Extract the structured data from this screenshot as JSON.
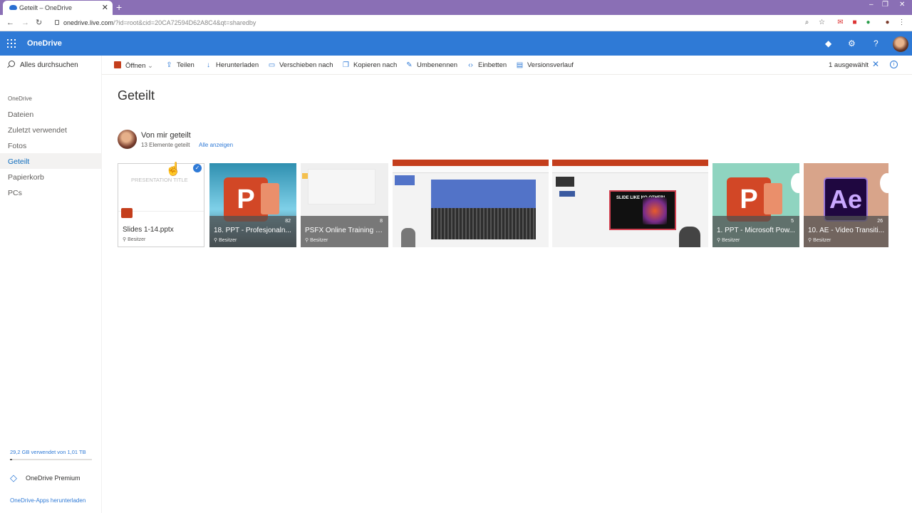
{
  "browser": {
    "tab_title": "Geteilt – OneDrive",
    "new_tab": "+",
    "url_host": "onedrive.live.com",
    "url_rest": "/?id=root&cid=20CA72594D62A8C4&qt=sharedby"
  },
  "suite": {
    "brand": "OneDrive",
    "icons": [
      "diamond-icon",
      "gear-icon",
      "help-icon"
    ]
  },
  "sidebar": {
    "search_label": "Alles durchsuchen",
    "section_label": "OneDrive",
    "items": [
      {
        "label": "Dateien",
        "active": false
      },
      {
        "label": "Zuletzt verwendet",
        "active": false
      },
      {
        "label": "Fotos",
        "active": false
      },
      {
        "label": "Geteilt",
        "active": true
      },
      {
        "label": "Papierkorb",
        "active": false
      },
      {
        "label": "PCs",
        "active": false
      }
    ],
    "storage_text": "29,2 GB verwendet von 1,01 TB",
    "storage_used_fraction": 0.03,
    "premium_label": "OneDrive Premium",
    "apps_label": "OneDrive-Apps herunterladen"
  },
  "commandbar": {
    "open": "Öffnen",
    "share": "Teilen",
    "download": "Herunterladen",
    "move": "Verschieben nach",
    "copy": "Kopieren nach",
    "rename": "Umbenennen",
    "embed": "Einbetten",
    "versions": "Versionsverlauf",
    "selection_count": "1 ausgewählt"
  },
  "main": {
    "page_title": "Geteilt",
    "section_title": "Von mir geteilt",
    "section_count": "13 Elemente geteilt",
    "show_all": "Alle anzeigen",
    "tiles": [
      {
        "name": "Slides 1-14.pptx",
        "role": "Besitzer",
        "count": "",
        "selected": true,
        "preview_text": "PRESENTATION TITLE"
      },
      {
        "name": "18. PPT - Profesjonaln...",
        "role": "Besitzer",
        "count": "82"
      },
      {
        "name": "PSFX Online Training -...",
        "role": "Besitzer",
        "count": "8"
      },
      {
        "name": "",
        "role": "",
        "count": ""
      },
      {
        "name": "",
        "role": "",
        "count": "",
        "slide_text": "SLIDE LIKE NO OTHER!"
      },
      {
        "name": "1. PPT - Microsoft Pow...",
        "role": "Besitzer",
        "count": "5"
      },
      {
        "name": "10. AE - Video Transiti...",
        "role": "Besitzer",
        "count": "26"
      }
    ]
  },
  "colors": {
    "suite_blue": "#2f7ad6",
    "tab_strip": "#8a6fb5",
    "powerpoint": "#d24726",
    "after_effects": "#1f0740"
  }
}
